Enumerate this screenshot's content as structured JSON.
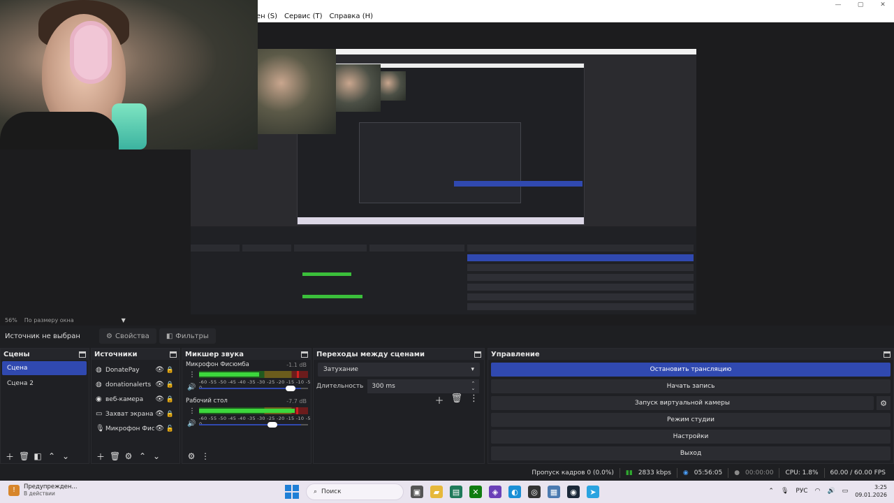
{
  "menu": {
    "items": [
      "ен (S)",
      "Сервис (T)",
      "Справка (H)"
    ]
  },
  "preview": {
    "zoom_percent": "56%",
    "fit_label": "По размеру окна"
  },
  "source_bar": {
    "no_source": "Источник не выбран",
    "properties": "Свойства",
    "filters": "Фильтры"
  },
  "scenes": {
    "title": "Сцены",
    "items": [
      "Сцена",
      "Сцена 2"
    ]
  },
  "sources": {
    "title": "Источники",
    "items": [
      {
        "label": "DonatePay",
        "icon": "globe-icon"
      },
      {
        "label": "donationalerts",
        "icon": "globe-icon"
      },
      {
        "label": "веб-камера",
        "icon": "camera-icon"
      },
      {
        "label": "Захват экрана",
        "icon": "monitor-icon"
      },
      {
        "label": "Микрофон Фиск",
        "icon": "microphone-icon"
      }
    ]
  },
  "mixer": {
    "title": "Микшер звука",
    "scale": "-60 -55 -50 -45 -40 -35 -30 -25 -20 -15 -10 -5 0",
    "channels": [
      {
        "name": "Микрофон Фисюмба",
        "db": "-1.1 dB",
        "level": 0.55,
        "peak": 0.9,
        "volume": 0.9
      },
      {
        "name": "Рабочий стол",
        "db": "-7.7 dB",
        "level": 0.88,
        "peak": 0.89,
        "volume": 0.72
      }
    ]
  },
  "transitions": {
    "title": "Переходы между сценами",
    "selected": "Затухание",
    "duration_label": "Длительность",
    "duration_value": "300 ms"
  },
  "controls": {
    "title": "Управление",
    "stop_stream": "Остановить трансляцию",
    "start_record": "Начать запись",
    "virtual_cam": "Запуск виртуальной камеры",
    "studio_mode": "Режим студии",
    "settings": "Настройки",
    "exit": "Выход"
  },
  "status": {
    "dropped": "Пропуск кадров 0 (0.0%)",
    "bitrate": "2833 kbps",
    "stream_time": "05:56:05",
    "record_time": "00:00:00",
    "cpu": "CPU: 1.8%",
    "fps": "60.00 / 60.00 FPS"
  },
  "taskbar": {
    "notification_title": "Предупрежден...",
    "notification_sub": "В действии",
    "search_placeholder": "Поиск",
    "lang": "РУС",
    "time": "3:25",
    "date": "09.01.2026"
  },
  "colors": {
    "accent": "#3049b0",
    "meter_green": "#3cd73c",
    "peak_red": "#d42020"
  }
}
